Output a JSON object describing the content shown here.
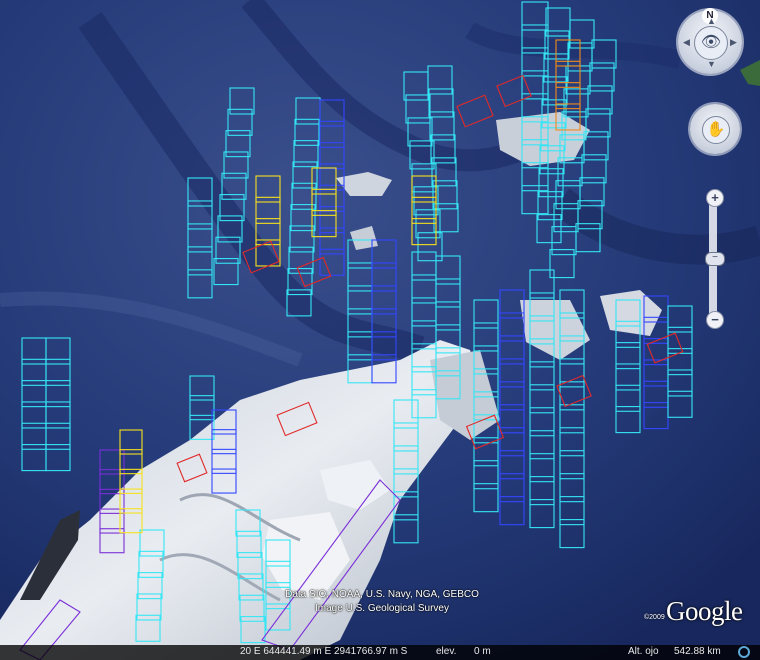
{
  "view": {
    "compass_letter": "N",
    "zoom_plus": "+",
    "zoom_minus": "−",
    "footprint_colors": {
      "cyan": "#35e6f5",
      "blue": "#3346ff",
      "yellow": "#f6e21d",
      "red": "#e02a2a",
      "purple": "#7a2ed8",
      "orange": "#f08a1c"
    }
  },
  "attribution": {
    "line1": "Data SIO, NOAA, U.S. Navy, NGA, GEBCO",
    "line2": "Image U.S. Geological Survey",
    "copyright": "©2009",
    "brand": "Google"
  },
  "status": {
    "coordinates": "20 E 644441.49 m E 2941766.97 m S",
    "elev_label": "elev.",
    "elev_value": "0 m",
    "alt_label": "Alt. ojo",
    "alt_value": "542.88 km"
  }
}
